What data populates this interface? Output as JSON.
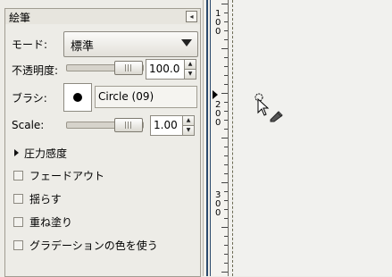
{
  "panel": {
    "title": "絵筆",
    "dock_icon": "tab-menu-icon",
    "mode": {
      "label": "モード:",
      "value": "標準"
    },
    "opacity": {
      "label": "不透明度:",
      "value": "100.0",
      "level_percent": 100
    },
    "brush": {
      "label": "ブラシ:",
      "name": "Circle (09)"
    },
    "scale": {
      "label": "Scale:",
      "value": "1.00"
    },
    "pressure": {
      "label": "圧力感度"
    },
    "options": [
      "フェードアウト",
      "揺らす",
      "重ね塗り",
      "グラデーションの色を使う"
    ]
  },
  "ruler": {
    "labels": [
      {
        "id": "100",
        "digits": [
          "1",
          "0",
          "0"
        ]
      },
      {
        "id": "200",
        "digits": [
          "2",
          "0",
          "0"
        ]
      },
      {
        "id": "300",
        "digits": [
          "3",
          "0",
          "0"
        ]
      }
    ]
  },
  "colors": {
    "pane_bg": "#edece7",
    "dock_edge": "#2c4a6d",
    "canvas_bg": "#f1f1ee"
  }
}
